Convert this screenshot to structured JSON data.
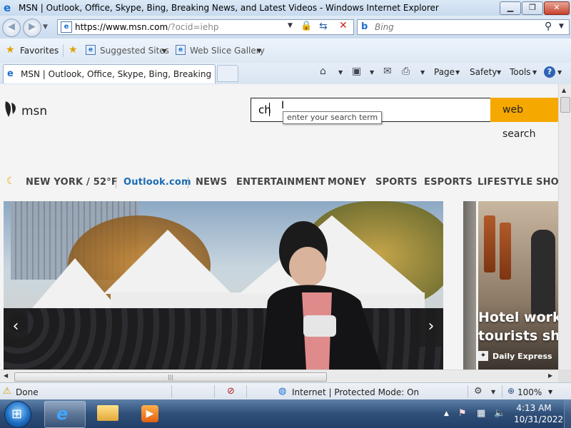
{
  "window": {
    "title": "MSN | Outlook, Office, Skype, Bing, Breaking News, and Latest Videos - Windows Internet Explorer",
    "min": "▁",
    "max": "❐",
    "close": "✕"
  },
  "address": {
    "url_host": "https://www.msn.com",
    "url_rest": "/?ocid=iehp"
  },
  "search_box": {
    "placeholder": "Bing"
  },
  "favorites_bar": {
    "favorites": "Favorites",
    "suggested_sites": "Suggested Sites",
    "web_slice_gallery": "Web Slice Gallery"
  },
  "tabs": [
    {
      "label": "MSN | Outlook, Office, Skype, Bing, Breaking Ne..."
    }
  ],
  "command_bar": {
    "page": "Page",
    "safety": "Safety",
    "tools": "Tools"
  },
  "msn": {
    "logo_text": "msn",
    "search_value": "ch",
    "search_button": "web search",
    "tooltip": "enter your search term",
    "nav": {
      "weather": "NEW YORK / 52°F",
      "items": [
        "Outlook.com",
        "NEWS",
        "ENTERTAINMENT",
        "MONEY",
        "SPORTS",
        "ESPORTS",
        "LIFESTYLE",
        "SHOI"
      ]
    },
    "side_card": {
      "headline_line1": "Hotel worker",
      "headline_line2": "tourists shou",
      "source": "Daily Express"
    }
  },
  "status_bar": {
    "done": "Done",
    "zone": "Internet | Protected Mode: On",
    "zoom": "100%"
  },
  "taskbar": {
    "time": "4:13 AM",
    "date": "10/31/2022"
  },
  "colors": {
    "accent_search": "#f5a800",
    "outlook_link": "#1a6bb3"
  }
}
